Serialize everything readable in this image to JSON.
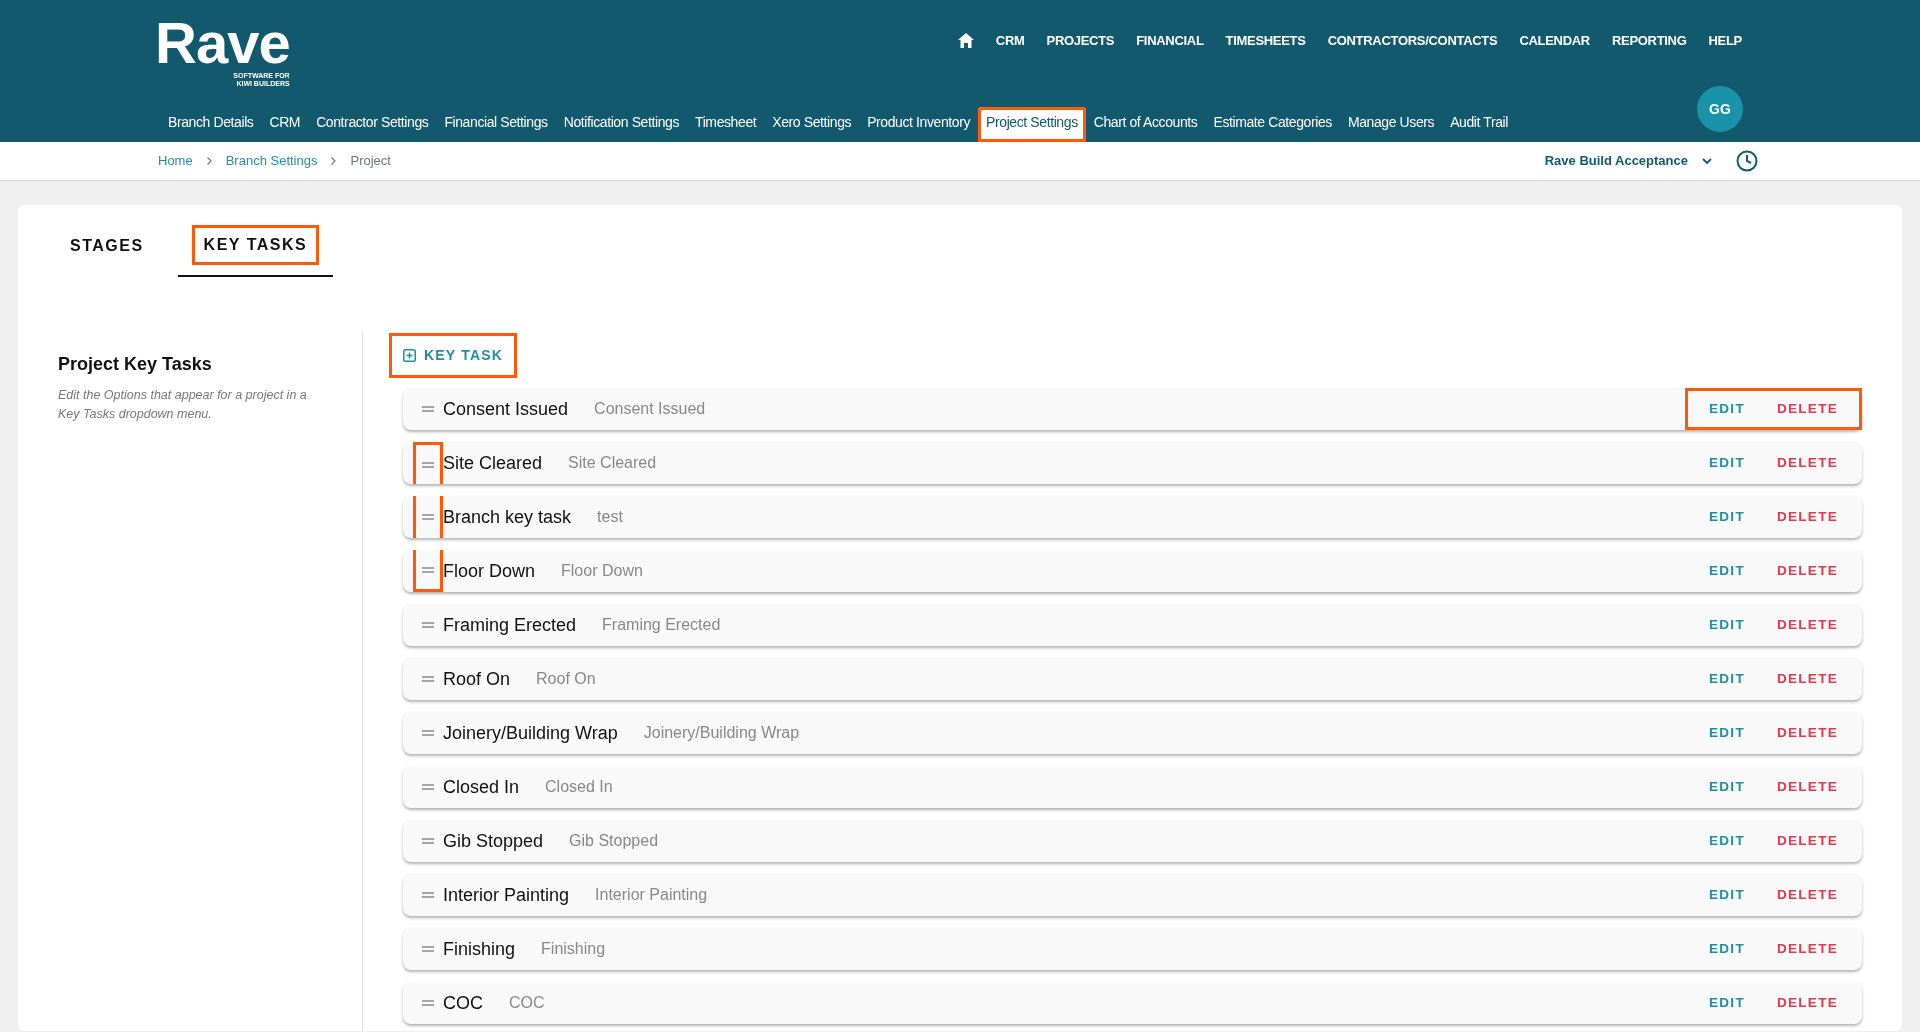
{
  "brand": {
    "name": "Rave",
    "tagline_1": "SOFTWARE FOR",
    "tagline_2": "KIWI BUILDERS"
  },
  "main_nav": [
    "CRM",
    "PROJECTS",
    "FINANCIAL",
    "TIMESHEETS",
    "CONTRACTORS/CONTACTS",
    "CALENDAR",
    "REPORTING",
    "HELP"
  ],
  "settings_nav": [
    {
      "label": "Branch Details",
      "selected": false,
      "highlighted": false
    },
    {
      "label": "CRM",
      "selected": false,
      "highlighted": false
    },
    {
      "label": "Contractor Settings",
      "selected": false,
      "highlighted": false
    },
    {
      "label": "Financial Settings",
      "selected": false,
      "highlighted": false
    },
    {
      "label": "Notification Settings",
      "selected": false,
      "highlighted": false
    },
    {
      "label": "Timesheet",
      "selected": false,
      "highlighted": false
    },
    {
      "label": "Xero Settings",
      "selected": false,
      "highlighted": false
    },
    {
      "label": "Product Inventory",
      "selected": false,
      "highlighted": false
    },
    {
      "label": "Project Settings",
      "selected": true,
      "highlighted": true
    },
    {
      "label": "Chart of Accounts",
      "selected": false,
      "highlighted": false
    },
    {
      "label": "Estimate Categories",
      "selected": false,
      "highlighted": false
    },
    {
      "label": "Manage Users",
      "selected": false,
      "highlighted": false
    },
    {
      "label": "Audit Trail",
      "selected": false,
      "highlighted": false
    }
  ],
  "avatar": "GG",
  "breadcrumb": [
    "Home",
    "Branch Settings",
    "Project"
  ],
  "branch_selector": "Rave Build Acceptance",
  "tabs": [
    {
      "label": "STAGES",
      "selected": false,
      "highlighted": false
    },
    {
      "label": "KEY TASKS",
      "selected": true,
      "highlighted": true
    }
  ],
  "section": {
    "title": "Project Key Tasks",
    "description": "Edit the Options that appear for a project in a Key Tasks dropdown menu."
  },
  "add_button": {
    "label": "KEY TASK",
    "highlighted": true
  },
  "key_tasks": [
    {
      "name": "Consent Issued",
      "description": "Consent Issued",
      "edit": "EDIT",
      "delete": "DELETE",
      "handle_highlighted": false,
      "actions_highlighted": true
    },
    {
      "name": "Site Cleared",
      "description": "Site Cleared",
      "edit": "EDIT",
      "delete": "DELETE",
      "handle_highlighted": true,
      "actions_highlighted": false
    },
    {
      "name": "Branch key task",
      "description": "test",
      "edit": "EDIT",
      "delete": "DELETE",
      "handle_highlighted": true,
      "actions_highlighted": false
    },
    {
      "name": "Floor Down",
      "description": "Floor Down",
      "edit": "EDIT",
      "delete": "DELETE",
      "handle_highlighted": true,
      "actions_highlighted": false
    },
    {
      "name": "Framing Erected",
      "description": "Framing Erected",
      "edit": "EDIT",
      "delete": "DELETE",
      "handle_highlighted": false,
      "actions_highlighted": false
    },
    {
      "name": "Roof On",
      "description": "Roof On",
      "edit": "EDIT",
      "delete": "DELETE",
      "handle_highlighted": false,
      "actions_highlighted": false
    },
    {
      "name": "Joinery/Building Wrap",
      "description": "Joinery/Building Wrap",
      "edit": "EDIT",
      "delete": "DELETE",
      "handle_highlighted": false,
      "actions_highlighted": false
    },
    {
      "name": "Closed In",
      "description": "Closed In",
      "edit": "EDIT",
      "delete": "DELETE",
      "handle_highlighted": false,
      "actions_highlighted": false
    },
    {
      "name": "Gib Stopped",
      "description": "Gib Stopped",
      "edit": "EDIT",
      "delete": "DELETE",
      "handle_highlighted": false,
      "actions_highlighted": false
    },
    {
      "name": "Interior Painting",
      "description": "Interior Painting",
      "edit": "EDIT",
      "delete": "DELETE",
      "handle_highlighted": false,
      "actions_highlighted": false
    },
    {
      "name": "Finishing",
      "description": "Finishing",
      "edit": "EDIT",
      "delete": "DELETE",
      "handle_highlighted": false,
      "actions_highlighted": false
    },
    {
      "name": "COC",
      "description": "COC",
      "edit": "EDIT",
      "delete": "DELETE",
      "handle_highlighted": false,
      "actions_highlighted": false
    }
  ]
}
